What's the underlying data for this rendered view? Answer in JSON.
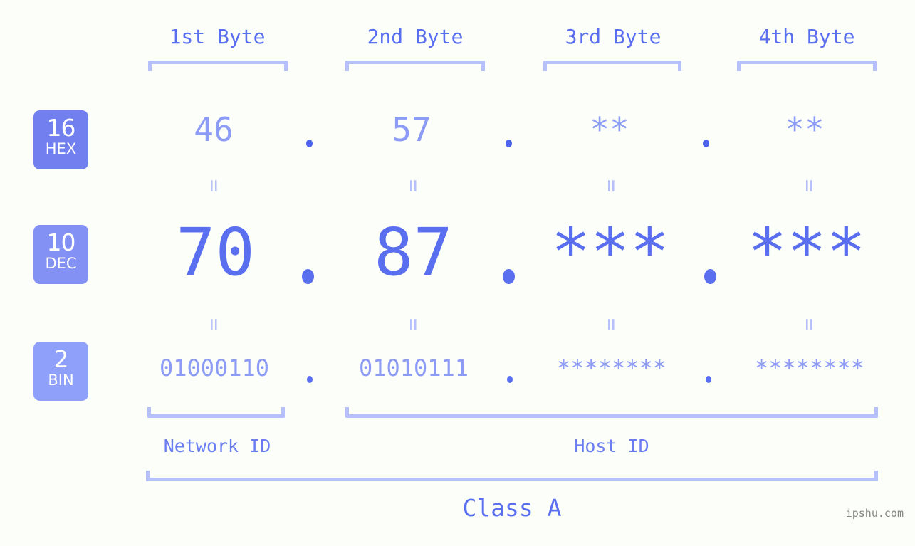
{
  "page": {
    "background": "#fcfefa",
    "accent": "#5a6ef0",
    "accent_light": "#8c9bf5",
    "bracket_color": "#b6c0fb",
    "watermark": "ipshu.com"
  },
  "headers": [
    {
      "label": "1st Byte"
    },
    {
      "label": "2nd Byte"
    },
    {
      "label": "3rd Byte"
    },
    {
      "label": "4th Byte"
    }
  ],
  "radix_badges": [
    {
      "number": "16",
      "label": "HEX",
      "color": "#7280ef"
    },
    {
      "number": "10",
      "label": "DEC",
      "color": "#8491f4"
    },
    {
      "number": "2",
      "label": "BIN",
      "color": "#8fa0fb"
    }
  ],
  "rows": {
    "hex": {
      "radix": "16",
      "name": "HEX",
      "values": [
        "46",
        "57",
        "**",
        "**"
      ]
    },
    "dec": {
      "radix": "10",
      "name": "DEC",
      "values": [
        "70",
        "87",
        "***",
        "***"
      ]
    },
    "bin": {
      "radix": "2",
      "name": "BIN",
      "values": [
        "01000110",
        "01010111",
        "********",
        "********"
      ]
    }
  },
  "separator": ".",
  "equals": "=",
  "segments": {
    "network_id": "Network ID",
    "host_id": "Host ID"
  },
  "class_label": "Class A"
}
